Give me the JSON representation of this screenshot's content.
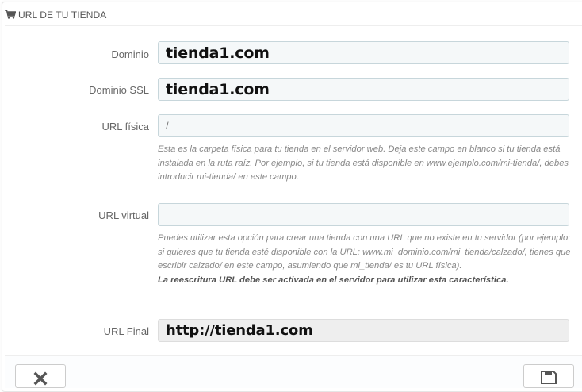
{
  "panel": {
    "title": "URL DE TU TIENDA",
    "title_icon": "shopping-cart-icon"
  },
  "fields": {
    "domain": {
      "label": "Dominio",
      "value": "tienda1.com"
    },
    "domain_ssl": {
      "label": "Dominio SSL",
      "value": "tienda1.com"
    },
    "physical_url": {
      "label": "URL física",
      "value": "/",
      "help": "Esta es la carpeta física para tu tienda en el servidor web. Deja este campo en blanco si tu tienda está instalada en la ruta raíz. Por ejemplo, si tu tienda está disponible en www.ejemplo.com/mi-tienda/, debes introducir mi-tienda/ en este campo."
    },
    "virtual_url": {
      "label": "URL virtual",
      "value": "",
      "help_1": "Puedes utilizar esta opción para crear una tienda con una URL que no existe en tu servidor (por ejemplo: si quieres que tu tienda esté disponible con la URL: www.mi_dominio.com/mi_tienda/calzado/, tienes que escribir calzado/ en este campo, asumiendo que mi_tienda/ es tu URL física).",
      "help_2": "La reescritura URL debe ser activada en el servidor para utilizar esta característica."
    },
    "final_url": {
      "label": "URL Final",
      "value": "http://tienda1.com"
    }
  },
  "footer": {
    "cancel_icon": "close-icon",
    "save_icon": "save-icon"
  }
}
